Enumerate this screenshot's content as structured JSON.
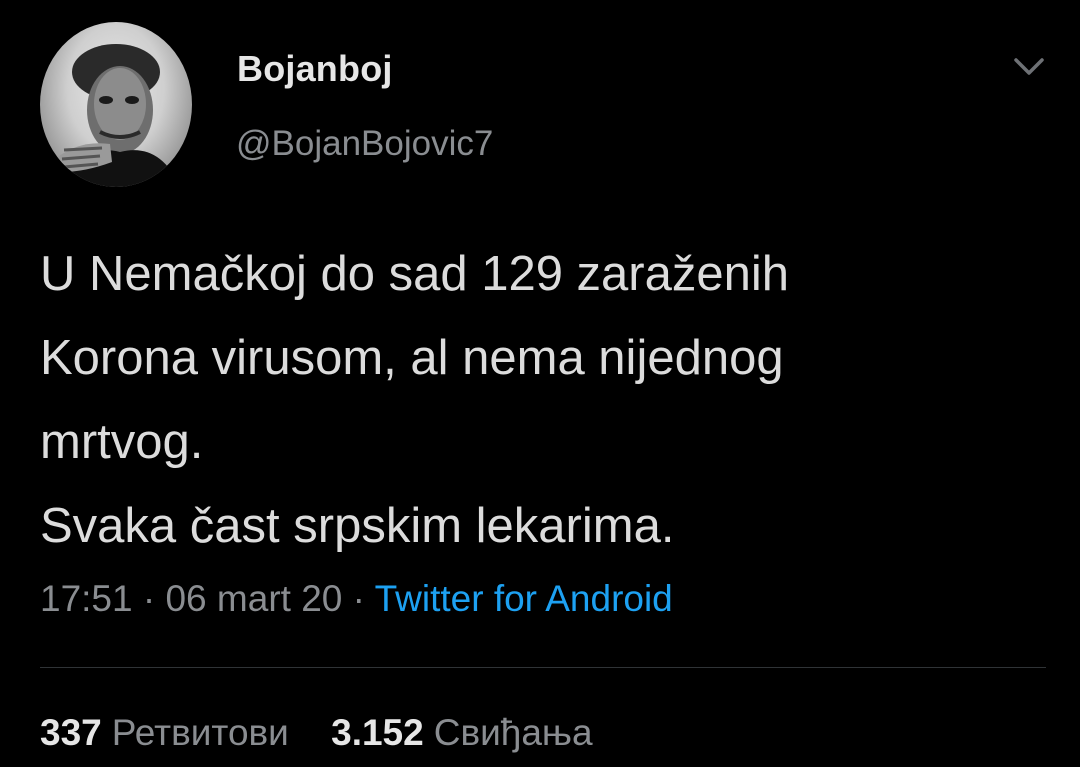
{
  "author": {
    "display_name": "Bojanboj",
    "handle": "@BojanBojovic7",
    "avatar_icon": "profile-photo"
  },
  "menu_icon": "chevron-down-icon",
  "tweet": {
    "lines": [
      "U Nemačkoj do sad 129 zaraženih",
      "Korona virusom, al nema nijednog",
      "mrtvog.",
      "Svaka čast srpskim lekarima."
    ]
  },
  "meta": {
    "time": "17:51",
    "separator": " · ",
    "date": "06 mart 20",
    "source": "Twitter for Android"
  },
  "stats": {
    "retweets_count": "337",
    "retweets_label": "Ретвитови",
    "likes_count": "3.152",
    "likes_label": "Свиђања"
  },
  "colors": {
    "background": "#000000",
    "link": "#1da1f2",
    "muted": "#8a8d91",
    "text": "#dcdcdc"
  }
}
